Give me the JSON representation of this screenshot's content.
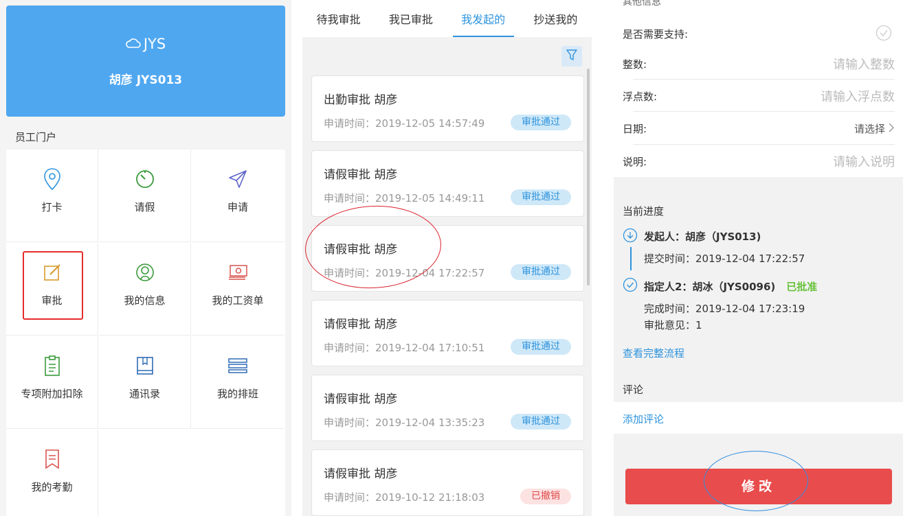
{
  "left": {
    "brand": "JYS",
    "user": "胡彦 JYS013",
    "section": "员工门户",
    "tiles": [
      {
        "label": "打卡",
        "icon": "location-pin-icon"
      },
      {
        "label": "请假",
        "icon": "timer-icon"
      },
      {
        "label": "申请",
        "icon": "paper-plane-icon"
      },
      {
        "label": "审批",
        "icon": "edit-icon"
      },
      {
        "label": "我的信息",
        "icon": "user-icon"
      },
      {
        "label": "我的工资单",
        "icon": "money-icon"
      },
      {
        "label": "专项附加扣除",
        "icon": "clipboard-icon"
      },
      {
        "label": "通讯录",
        "icon": "book-icon"
      },
      {
        "label": "我的排班",
        "icon": "schedule-icon"
      },
      {
        "label": "我的考勤",
        "icon": "bookmark-icon"
      }
    ]
  },
  "middle": {
    "tabs": [
      "待我审批",
      "我已审批",
      "我发起的",
      "抄送我的"
    ],
    "active_tab": 2,
    "cards": [
      {
        "title": "出勤审批 胡彦",
        "time": "申请时间：2019-12-05 14:57:49",
        "status": "审批通过"
      },
      {
        "title": "请假审批 胡彦",
        "time": "申请时间：2019-12-05 14:49:11",
        "status": "审批通过"
      },
      {
        "title": "请假审批 胡彦",
        "time": "申请时间：2019-12-04 17:22:57",
        "status": "审批通过"
      },
      {
        "title": "请假审批 胡彦",
        "time": "申请时间：2019-12-04 17:10:51",
        "status": "审批通过"
      },
      {
        "title": "请假审批 胡彦",
        "time": "申请时间：2019-12-04 13:35:23",
        "status": "审批通过"
      },
      {
        "title": "请假审批 胡彦",
        "time": "申请时间：2019-10-12 21:18:03",
        "status": "已撤销"
      }
    ]
  },
  "right": {
    "section_top": "其他信息",
    "fields": [
      {
        "label": "是否需要支持:",
        "value": ""
      },
      {
        "label": "整数:",
        "value": "请输入整数"
      },
      {
        "label": "浮点数:",
        "value": "请输入浮点数"
      },
      {
        "label": "日期:",
        "value": "请选择"
      },
      {
        "label": "说明:",
        "value": "请输入说明"
      }
    ],
    "progress_label": "当前进度",
    "step1": {
      "name": "发起人：胡彦（JYS013)",
      "sub": "提交时间：2019-12-04 17:22:57"
    },
    "step2": {
      "name": "指定人2：胡冰（JYS0096)",
      "status": "已批准",
      "sub1": "完成时间：2019-12-04 17:23:19",
      "sub2": "审批意见：1"
    },
    "view_flow": "查看完整流程",
    "comment_label": "评论",
    "add_comment": "添加评论",
    "modify": "修改"
  }
}
